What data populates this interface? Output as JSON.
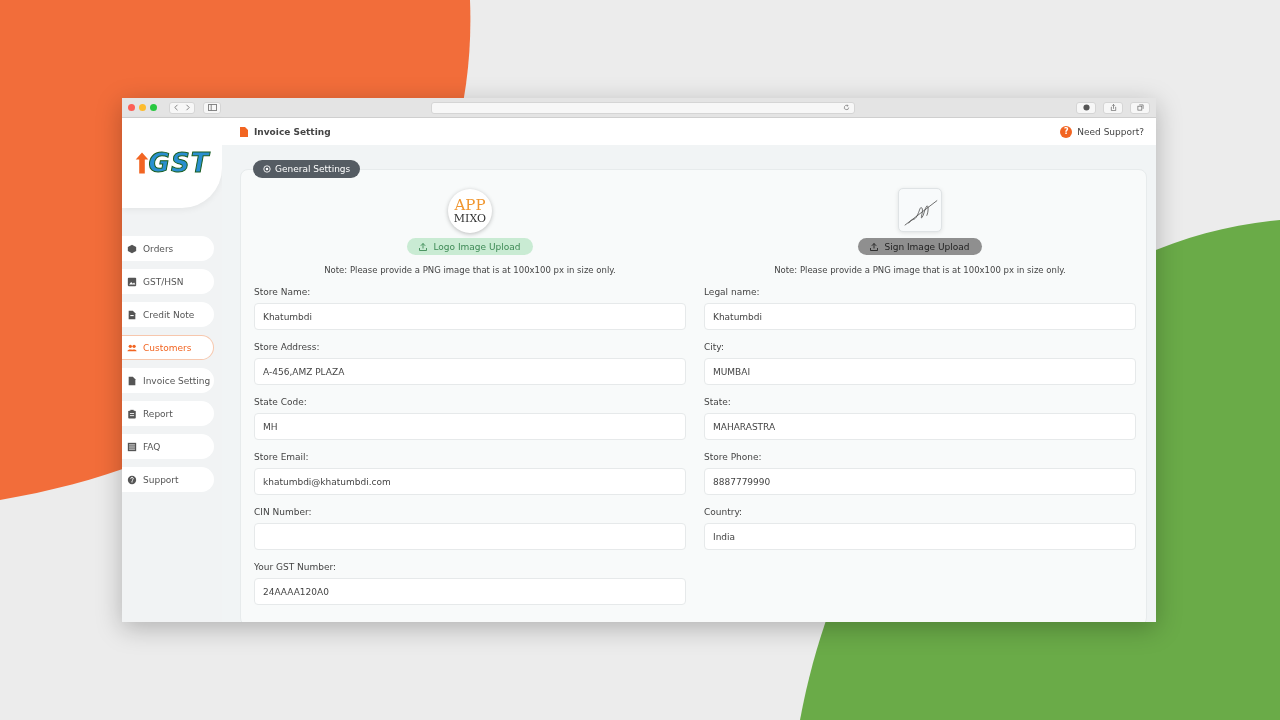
{
  "sidebar": {
    "logo_text": "GST",
    "items": [
      {
        "label": "Orders",
        "kind": "box",
        "selected": false
      },
      {
        "label": "GST/HSN",
        "kind": "image",
        "selected": false
      },
      {
        "label": "Credit Note",
        "kind": "doc",
        "selected": false
      },
      {
        "label": "Customers",
        "kind": "people",
        "selected": true
      },
      {
        "label": "Invoice Setting",
        "kind": "file",
        "selected": false
      },
      {
        "label": "Report",
        "kind": "clipboard",
        "selected": false
      },
      {
        "label": "FAQ",
        "kind": "list",
        "selected": false
      },
      {
        "label": "Support",
        "kind": "help",
        "selected": false
      }
    ]
  },
  "header": {
    "title": "Invoice Setting",
    "support_icon": "?",
    "support": "Need Support?"
  },
  "section": {
    "title": "General Settings"
  },
  "uploads": [
    {
      "kind": "logo",
      "logo_text": [
        "APP",
        "MIXO"
      ],
      "button": "Logo Image Upload",
      "note": "Note: Please provide a PNG image that is at 100x100 px in size only."
    },
    {
      "kind": "signature",
      "button": "Sign Image Upload",
      "note": "Note: Please provide a PNG image that is at 100x100 px in size only."
    }
  ],
  "fields": {
    "left": [
      {
        "label": "Store Name:",
        "value": "Khatumbdi"
      },
      {
        "label": "Store Address:",
        "value": "A-456,AMZ PLAZA"
      },
      {
        "label": "State Code:",
        "value": "MH"
      },
      {
        "label": "Store Email:",
        "value": "khatumbdi@khatumbdi.com"
      },
      {
        "label": "CIN Number:"
      },
      {
        "label": "Your GST Number:",
        "value": "24AAAA120A0"
      }
    ],
    "right": [
      {
        "label": "Legal name:",
        "value": "Khatumbdi"
      },
      {
        "label": "City:",
        "value": "MUMBAI"
      },
      {
        "label": "State:",
        "value": "MAHARASTRA"
      },
      {
        "label": "Store Phone:",
        "value": "8887779990"
      },
      {
        "label": "Country:",
        "value": "India"
      }
    ]
  }
}
